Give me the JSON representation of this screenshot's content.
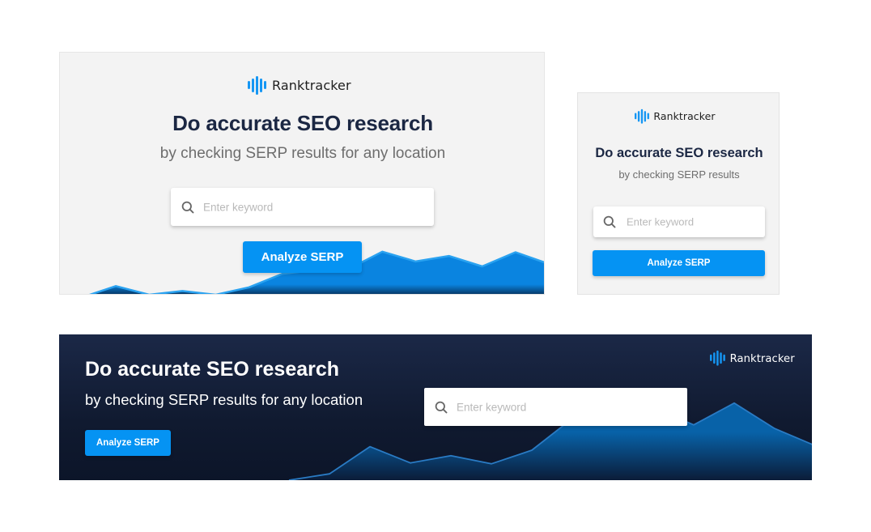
{
  "brand": {
    "name": "Ranktracker",
    "logo_icon": "sound-wave-bars-icon",
    "accent_color": "#0593f3",
    "logo_mark_color": "#1596f3",
    "title_color": "#1b2743",
    "dark_bg_color": "#121c34",
    "light_bg_color": "#f3f3f3"
  },
  "banners": {
    "large": {
      "logo_text": "Ranktracker",
      "title": "Do accurate SEO research",
      "subtitle": "by checking SERP results for any location",
      "search_placeholder": "Enter keyword",
      "search_icon": "search-icon",
      "button_label": "Analyze SERP"
    },
    "square": {
      "logo_text": "Ranktracker",
      "title": "Do accurate SEO research",
      "subtitle": "by checking SERP results",
      "search_placeholder": "Enter keyword",
      "search_icon": "search-icon",
      "button_label": "Analyze SERP"
    },
    "leaderboard": {
      "logo_text": "Ranktracker",
      "title": "Do accurate SEO research",
      "subtitle": "by checking SERP results for any location",
      "search_placeholder": "Enter keyword",
      "search_icon": "search-icon",
      "button_label": "Analyze SERP"
    }
  },
  "decorative_charts": {
    "large": {
      "type": "area",
      "values": [
        0,
        18,
        4,
        10,
        4,
        16,
        38,
        44,
        46,
        74,
        58,
        67,
        50,
        73,
        54
      ]
    },
    "leaderboard": {
      "type": "area",
      "values": [
        0,
        7,
        37,
        19,
        27,
        18,
        33,
        68,
        70,
        80,
        61,
        85,
        57,
        38
      ]
    }
  }
}
